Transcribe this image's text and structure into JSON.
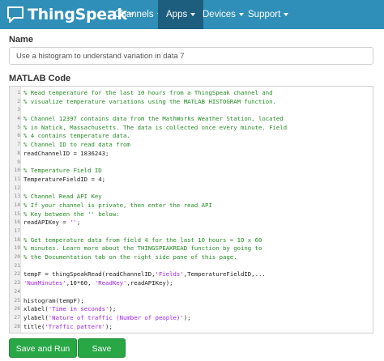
{
  "navbar": {
    "brand": "ThingSpeak",
    "brand_tm": "™",
    "icon": "chat-bubble-icon",
    "menus": [
      {
        "label": "Channels"
      },
      {
        "label": "Apps"
      },
      {
        "label": "Devices"
      },
      {
        "label": "Support"
      }
    ],
    "active_menu": "Apps",
    "colors": {
      "bar": "#2f8fb8",
      "active": "#1d5e7f"
    }
  },
  "form": {
    "name_label": "Name",
    "name_value": "Use a histogram to understand variation in data 7",
    "code_label": "MATLAB Code"
  },
  "code_lines": [
    {
      "n": "1",
      "text": "% Read temperature for the last 10 hours from a ThingSpeak channel and",
      "kind": "cmt"
    },
    {
      "n": "2",
      "text": "% visualize temperature variations using the MATLAB HISTOGRAM function.",
      "kind": "cmt"
    },
    {
      "n": "3",
      "text": "",
      "kind": "plain"
    },
    {
      "n": "4",
      "text": "% Channel 12397 contains data from the MathWorks Weather Station, located",
      "kind": "cmt"
    },
    {
      "n": "5",
      "text": "% in Natick, Massachusetts. The data is collected once every minute. Field",
      "kind": "cmt"
    },
    {
      "n": "6",
      "text": "% 4 contains temperature data.",
      "kind": "cmt"
    },
    {
      "n": "7",
      "text": "% Channel ID to read data from",
      "kind": "cmt"
    },
    {
      "n": "8",
      "text": "readChannelID = 1836243;",
      "kind": "plain"
    },
    {
      "n": "9",
      "text": "",
      "kind": "plain"
    },
    {
      "n": "10",
      "text": "% Temperature Field ID",
      "kind": "cmt"
    },
    {
      "n": "11",
      "text": "TemperatureFieldID = 4;",
      "kind": "plain"
    },
    {
      "n": "12",
      "text": "",
      "kind": "plain"
    },
    {
      "n": "13",
      "text": "% Channel Read API Key",
      "kind": "cmt"
    },
    {
      "n": "14",
      "text": "% If your channel is private, then enter the read API",
      "kind": "cmt"
    },
    {
      "n": "15",
      "text": "% Key between the '' below:",
      "kind": "cmt"
    },
    {
      "n": "16",
      "text": "readAPIKey = '';",
      "kind": "plain"
    },
    {
      "n": "17",
      "text": "",
      "kind": "plain"
    },
    {
      "n": "18",
      "text": "% Get temperature data from field 4 for the last 10 hours = 10 x 60",
      "kind": "cmt"
    },
    {
      "n": "19",
      "text": "% minutes. Learn more about the THINGSPEAKREAD function by going to",
      "kind": "cmt"
    },
    {
      "n": "20",
      "text": "% the Documentation tab on the right side pane of this page.",
      "kind": "cmt"
    },
    {
      "n": "21",
      "text": "",
      "kind": "plain"
    },
    {
      "n": "22",
      "text": "tempF = thingSpeakRead(readChannelID,'Fields',TemperatureFieldID,...",
      "kind": "plain"
    },
    {
      "n": "23",
      "text": "'NumMinutes',10*60, 'ReadKey',readAPIKey);",
      "kind": "plain"
    },
    {
      "n": "24",
      "text": "",
      "kind": "plain"
    },
    {
      "n": "25",
      "text": "histogram(tempF);",
      "kind": "plain"
    },
    {
      "n": "26",
      "text": "xlabel('Time in seconds');",
      "kind": "plain"
    },
    {
      "n": "27",
      "text": "ylabel('Nature of traffic (Number of people)');",
      "kind": "plain"
    },
    {
      "n": "28",
      "text": "title('Traffic pattern');",
      "kind": "plain"
    }
  ],
  "code_colors": {
    "comment": "#228b22",
    "string": "#a020f0",
    "text": "#1a1a1a"
  },
  "buttons": {
    "save_run": "Save and Run",
    "save": "Save",
    "color": "#28a745"
  }
}
